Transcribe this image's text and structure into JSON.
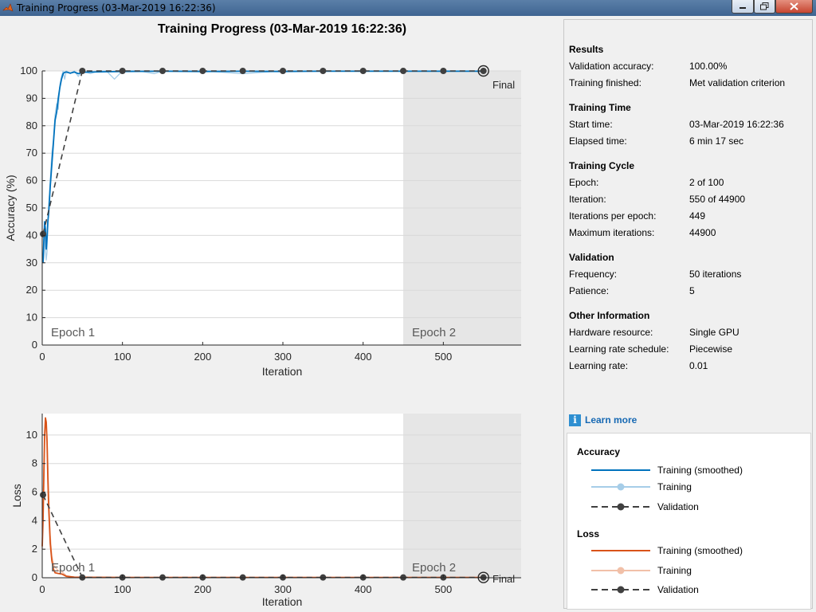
{
  "window": {
    "title": "Training Progress (03-Mar-2019 16:22:36)",
    "controls": [
      "minimize-icon",
      "maximize-icon",
      "close-icon"
    ]
  },
  "main_title": "Training Progress (03-Mar-2019 16:22:36)",
  "accuracy_plot": {
    "ylabel": "Accuracy (%)",
    "xlabel": "Iteration",
    "final_label": "Final",
    "epoch_labels": [
      "Epoch 1",
      "Epoch 2"
    ],
    "y_ticks": [
      "0",
      "10",
      "20",
      "30",
      "40",
      "50",
      "60",
      "70",
      "80",
      "90",
      "100"
    ],
    "x_ticks": [
      "0",
      "100",
      "200",
      "300",
      "400",
      "500"
    ]
  },
  "loss_plot": {
    "ylabel": "Loss",
    "xlabel": "Iteration",
    "final_label": "Final",
    "epoch_labels": [
      "Epoch 1",
      "Epoch 2"
    ],
    "y_ticks": [
      "0",
      "2",
      "4",
      "6",
      "8",
      "10"
    ],
    "x_ticks": [
      "0",
      "100",
      "200",
      "300",
      "400",
      "500"
    ]
  },
  "chart_data": [
    {
      "type": "line",
      "ylabel": "Accuracy (%)",
      "xlabel": "Iteration",
      "xlim": [
        0,
        597
      ],
      "ylim": [
        0,
        100
      ],
      "epoch_boundaries": [
        0,
        449
      ],
      "series": [
        {
          "name": "Training (smoothed)",
          "color": "#0072bd",
          "x": [
            1,
            2,
            3,
            4,
            5,
            6,
            7,
            8,
            10,
            12,
            14,
            16,
            18,
            20,
            22,
            24,
            26,
            28,
            30,
            35,
            40,
            45,
            50,
            60,
            80,
            100,
            150,
            200,
            250,
            300,
            350,
            400,
            450,
            500,
            550
          ],
          "y": [
            30,
            38,
            45,
            42,
            35,
            39,
            45,
            48,
            58,
            66,
            74,
            82,
            85,
            90,
            94,
            97,
            99,
            99.5,
            99.6,
            99.2,
            99.6,
            99,
            99.5,
            99.6,
            99.7,
            99.8,
            99.9,
            99.8,
            99.9,
            99.8,
            99.9,
            99.9,
            99.9,
            99.9,
            99.9
          ]
        },
        {
          "name": "Training",
          "color": "#a6cde8",
          "x": [
            1,
            2,
            3,
            4,
            5,
            6,
            7,
            8,
            10,
            12,
            14,
            16,
            18,
            20,
            22,
            24,
            26,
            28,
            30,
            35,
            40,
            45,
            50,
            60,
            70,
            80,
            90,
            100,
            120,
            140,
            150,
            180,
            200,
            250,
            300,
            350,
            400,
            450,
            500,
            550
          ],
          "y": [
            30,
            32,
            40,
            35,
            31,
            34,
            45,
            50,
            60,
            70,
            75,
            84,
            88,
            86,
            95,
            98,
            100,
            97,
            100,
            99,
            100,
            98,
            100,
            99,
            100,
            100,
            97,
            100,
            100,
            99,
            100,
            100,
            100,
            99,
            100,
            100,
            100,
            100,
            100,
            100
          ]
        },
        {
          "name": "Validation",
          "color": "#404040",
          "x": [
            1,
            50,
            100,
            150,
            200,
            250,
            300,
            350,
            400,
            450,
            500,
            550
          ],
          "y": [
            40.5,
            100,
            100,
            100,
            100,
            100,
            100,
            100,
            100,
            100,
            100,
            100
          ]
        }
      ]
    },
    {
      "type": "line",
      "ylabel": "Loss",
      "xlabel": "Iteration",
      "xlim": [
        0,
        597
      ],
      "ylim": [
        0,
        11.5
      ],
      "epoch_boundaries": [
        0,
        449
      ],
      "series": [
        {
          "name": "Training (smoothed)",
          "color": "#d95319",
          "x": [
            0,
            1,
            2,
            3,
            4,
            5,
            6,
            7,
            8,
            10,
            12,
            14,
            16,
            20,
            25,
            30,
            40,
            60,
            100,
            200,
            300,
            400,
            500,
            550
          ],
          "y": [
            2.2,
            4,
            7,
            10,
            11.2,
            10.9,
            9.5,
            7,
            5,
            2.4,
            1.2,
            0.6,
            0.35,
            0.3,
            0.25,
            0.1,
            0.04,
            0.03,
            0.02,
            0.02,
            0.02,
            0.02,
            0.02,
            0.02
          ]
        },
        {
          "name": "Training",
          "color": "#f1c0a8",
          "x": [
            0,
            2,
            4,
            6,
            8,
            10,
            12,
            15,
            20,
            25,
            30,
            40,
            60,
            100,
            200,
            300,
            400,
            500,
            550
          ],
          "y": [
            2,
            8,
            11,
            10,
            6,
            3,
            1.5,
            0.8,
            0.5,
            0.4,
            0.15,
            0.05,
            0.04,
            0.03,
            0.02,
            0.02,
            0.02,
            0.02,
            0.02
          ]
        },
        {
          "name": "Validation",
          "color": "#404040",
          "x": [
            1,
            50,
            100,
            150,
            200,
            250,
            300,
            350,
            400,
            450,
            500,
            550
          ],
          "y": [
            5.8,
            0.02,
            0.02,
            0.02,
            0.02,
            0.02,
            0.02,
            0.02,
            0.02,
            0.02,
            0.02,
            0.02
          ]
        }
      ]
    }
  ],
  "results": {
    "sections": [
      {
        "title": "Results",
        "rows": [
          {
            "label": "Validation accuracy:",
            "value": "100.00%"
          },
          {
            "label": "Training finished:",
            "value": "Met validation criterion"
          }
        ]
      },
      {
        "title": "Training Time",
        "rows": [
          {
            "label": "Start time:",
            "value": "03-Mar-2019 16:22:36"
          },
          {
            "label": "Elapsed time:",
            "value": "6 min 17 sec"
          }
        ]
      },
      {
        "title": "Training Cycle",
        "rows": [
          {
            "label": "Epoch:",
            "value": "2 of 100"
          },
          {
            "label": "Iteration:",
            "value": "550 of 44900"
          },
          {
            "label": "Iterations per epoch:",
            "value": "449"
          },
          {
            "label": "Maximum iterations:",
            "value": "44900"
          }
        ]
      },
      {
        "title": "Validation",
        "rows": [
          {
            "label": "Frequency:",
            "value": "50 iterations"
          },
          {
            "label": "Patience:",
            "value": "5"
          }
        ]
      },
      {
        "title": "Other Information",
        "rows": [
          {
            "label": "Hardware resource:",
            "value": "Single GPU"
          },
          {
            "label": "Learning rate schedule:",
            "value": "Piecewise"
          },
          {
            "label": "Learning rate:",
            "value": "0.01"
          }
        ]
      }
    ]
  },
  "learn_more": {
    "icon": "info-icon",
    "label": "Learn more"
  },
  "legend": {
    "accuracy_header": "Accuracy",
    "loss_header": "Loss",
    "accuracy_items": [
      {
        "label": "Training (smoothed)",
        "color": "#0072bd",
        "style": "solid"
      },
      {
        "label": "Training",
        "color": "#a6cde8",
        "style": "solid-dot"
      },
      {
        "label": "Validation",
        "color": "#404040",
        "style": "dashed-dot"
      }
    ],
    "loss_items": [
      {
        "label": "Training (smoothed)",
        "color": "#d95319",
        "style": "solid"
      },
      {
        "label": "Training",
        "color": "#f1c0a8",
        "style": "solid-dot"
      },
      {
        "label": "Validation",
        "color": "#404040",
        "style": "dashed-dot"
      }
    ]
  }
}
